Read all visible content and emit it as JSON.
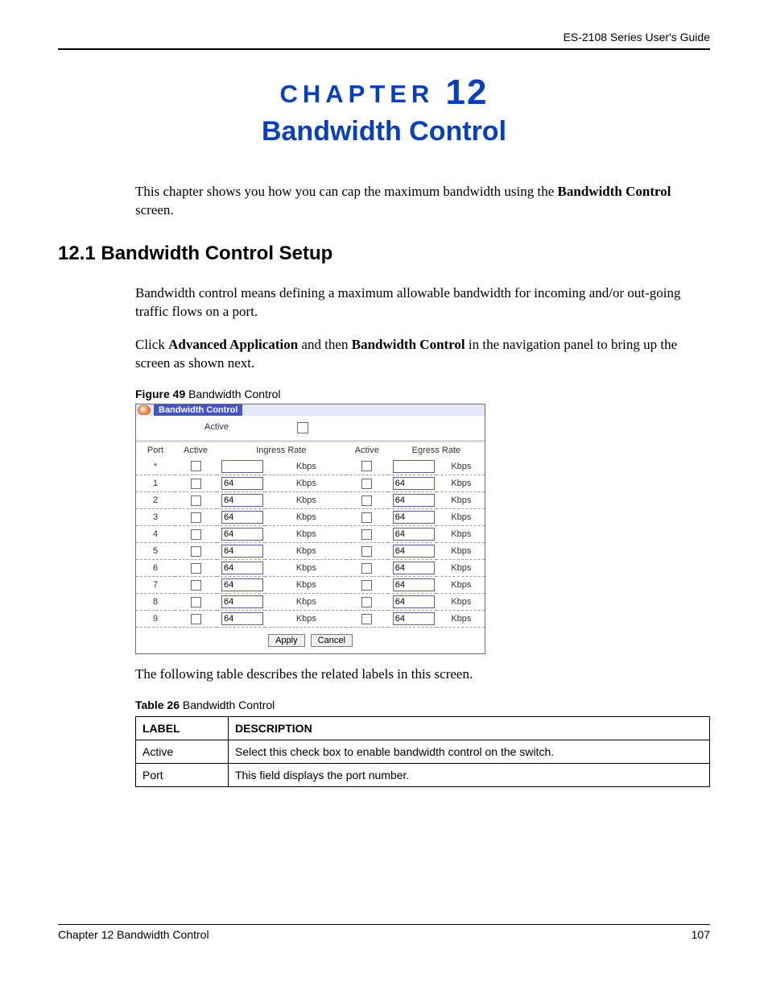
{
  "header": {
    "guide_title": "ES-2108 Series User's Guide"
  },
  "chapter": {
    "label_word": "CHAPTER",
    "label_num": " 12",
    "title": "Bandwidth Control"
  },
  "intro": {
    "pre": "This chapter shows you how you can cap the maximum bandwidth using the ",
    "bold": "Bandwidth Control",
    "post": " screen."
  },
  "section": {
    "heading": "12.1  Bandwidth Control Setup"
  },
  "para1": "Bandwidth control means defining a maximum allowable bandwidth for incoming and/or out-going traffic flows on a port.",
  "para2": {
    "pre": "Click ",
    "b1": "Advanced Application",
    "mid": " and then ",
    "b2": "Bandwidth Control",
    "post": " in the navigation panel to bring up the screen as shown next."
  },
  "figure": {
    "caption_bold": "Figure 49",
    "caption_rest": "   Bandwidth Control",
    "panel_title": "Bandwidth Control",
    "active_label": "Active",
    "headers": {
      "port": "Port",
      "active1": "Active",
      "ingress": "Ingress Rate",
      "active2": "Active",
      "egress": "Egress Rate"
    },
    "kbps": "Kbps",
    "rows": [
      {
        "port": "*",
        "ingress": "",
        "egress": ""
      },
      {
        "port": "1",
        "ingress": "64",
        "egress": "64"
      },
      {
        "port": "2",
        "ingress": "64",
        "egress": "64"
      },
      {
        "port": "3",
        "ingress": "64",
        "egress": "64"
      },
      {
        "port": "4",
        "ingress": "64",
        "egress": "64"
      },
      {
        "port": "5",
        "ingress": "64",
        "egress": "64"
      },
      {
        "port": "6",
        "ingress": "64",
        "egress": "64"
      },
      {
        "port": "7",
        "ingress": "64",
        "egress": "64"
      },
      {
        "port": "8",
        "ingress": "64",
        "egress": "64"
      },
      {
        "port": "9",
        "ingress": "64",
        "egress": "64"
      }
    ],
    "buttons": {
      "apply": "Apply",
      "cancel": "Cancel"
    }
  },
  "after_fig": "The following table describes the related labels in this screen.",
  "table": {
    "caption_bold": "Table 26",
    "caption_rest": "   Bandwidth Control",
    "h_label": "LABEL",
    "h_desc": "DESCRIPTION",
    "rows": [
      {
        "label": "Active",
        "desc": "Select this check box to enable bandwidth control on the switch."
      },
      {
        "label": "Port",
        "desc": "This field displays the port number."
      }
    ]
  },
  "footer": {
    "left": "Chapter 12 Bandwidth Control",
    "right": "107"
  }
}
